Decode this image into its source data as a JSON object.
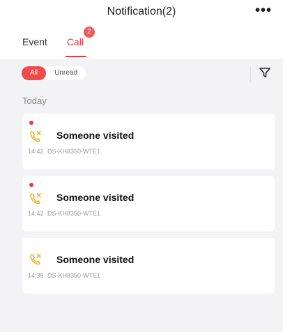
{
  "header": {
    "title": "Notification(2)",
    "more_label": "•••"
  },
  "tabs": [
    {
      "label": "Event",
      "active": false
    },
    {
      "label": "Call",
      "active": true,
      "badge": "2"
    }
  ],
  "filters": {
    "options": [
      {
        "label": "All",
        "active": true
      },
      {
        "label": "Unread",
        "active": false
      }
    ],
    "filter_icon": "funnel-icon"
  },
  "section": {
    "label": "Today"
  },
  "notifications": [
    {
      "title": "Someone visited",
      "time": "14:42",
      "device": "DS-KH8350-WTE1",
      "unread": true,
      "icon": "missed-call-icon"
    },
    {
      "title": "Someone visited",
      "time": "14:42",
      "device": "DS-KH8350-WTE1",
      "unread": true,
      "icon": "missed-call-icon"
    },
    {
      "title": "Someone visited",
      "time": "14:39",
      "device": "DS-KH8350-WTE1",
      "unread": false,
      "icon": "missed-call-icon"
    }
  ],
  "colors": {
    "accent": "#e53a3a",
    "call_icon": "#e8b624",
    "background": "#f3f3f5"
  }
}
